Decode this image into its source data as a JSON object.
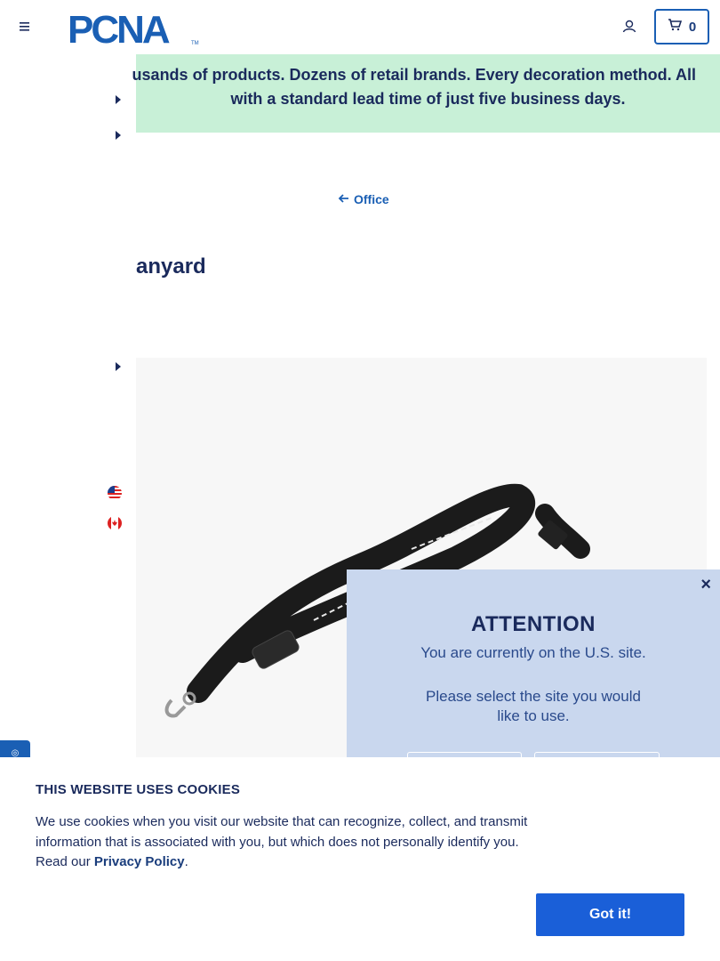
{
  "header": {
    "brand": "PCNA",
    "cart_count": "0"
  },
  "promo": {
    "line1": "usands of products. Dozens of retail brands. Every decoration method. All",
    "line2": "with a standard lead time of just five business days."
  },
  "breadcrumb": {
    "label": "Office"
  },
  "product": {
    "title_fragment": "anyard"
  },
  "attention": {
    "title": "ATTENTION",
    "message": "You are currently on the U.S. site.",
    "prompt": "Please select the site you would like to use.",
    "close": "×"
  },
  "cookie": {
    "title": "THIS WEBSITE USES COOKIES",
    "body": "We use cookies when you visit our website that can recognize, collect, and transmit information that is associated with you, but which does not personally identify you. Read our ",
    "link": "Privacy Policy",
    "end": ".",
    "button": "Got it!"
  },
  "colors": {
    "navy": "#1a2a5c",
    "blue": "#1a5fb4",
    "promo_bg": "#c8f0d7",
    "modal_bg": "#c9d7ee",
    "cta": "#1a5fd8"
  }
}
